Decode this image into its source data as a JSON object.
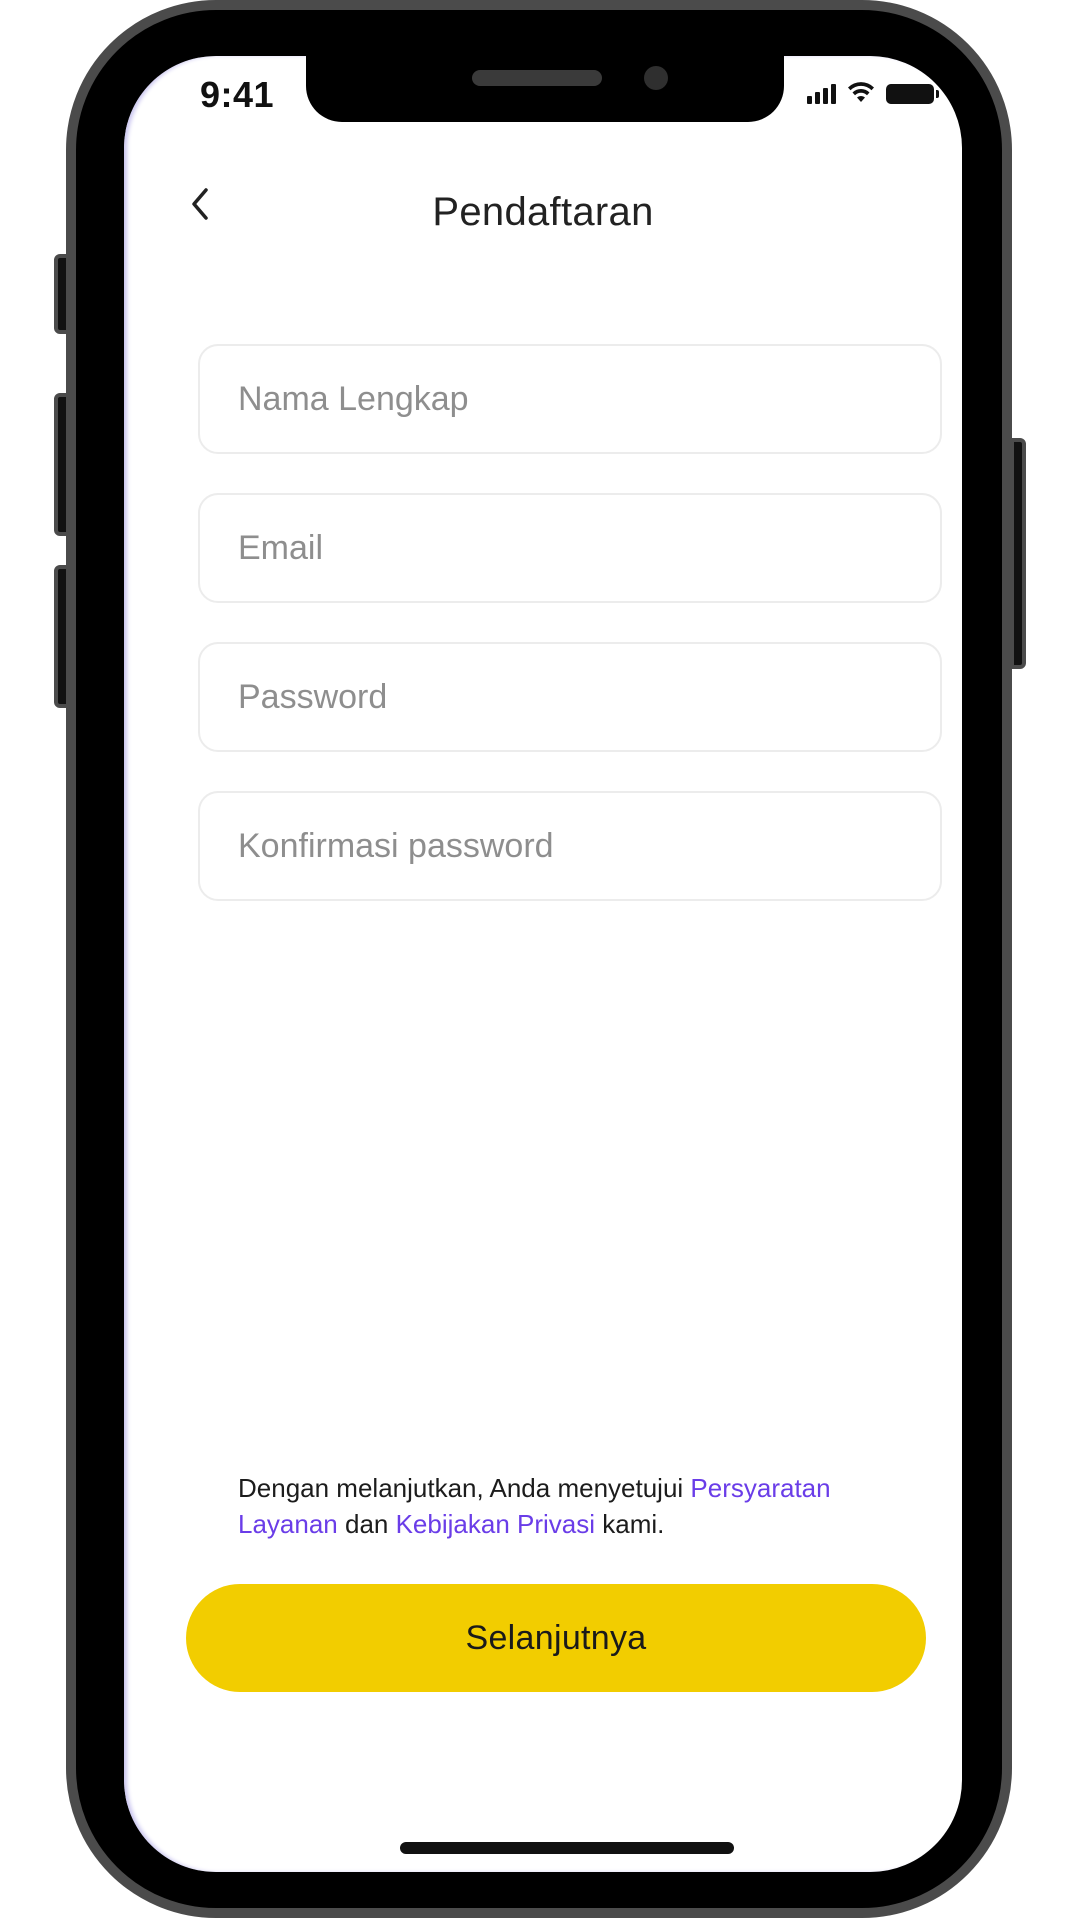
{
  "status_bar": {
    "time": "9:41",
    "icons": [
      "signal-icon",
      "wifi-icon",
      "battery-icon"
    ]
  },
  "header": {
    "title": "Pendaftaran",
    "back_icon": "chevron-left-icon"
  },
  "form": {
    "full_name": {
      "placeholder": "Nama Lengkap",
      "value": ""
    },
    "email": {
      "placeholder": "Email",
      "value": ""
    },
    "password": {
      "placeholder": "Password",
      "value": ""
    },
    "confirm_password": {
      "placeholder": "Konfirmasi password",
      "value": ""
    }
  },
  "terms": {
    "prefix": "Dengan melanjutkan, Anda menyetujui ",
    "terms_link": "Persyaratan Layanan",
    "middle": " dan ",
    "privacy_link": "Kebijakan Privasi",
    "suffix": " kami."
  },
  "next_button": {
    "label": "Selanjutnya"
  },
  "colors": {
    "accent": "#f2cd00",
    "link": "#6a3de8",
    "frame": "#4b4b4b",
    "placeholder": "#8e8e8e"
  }
}
